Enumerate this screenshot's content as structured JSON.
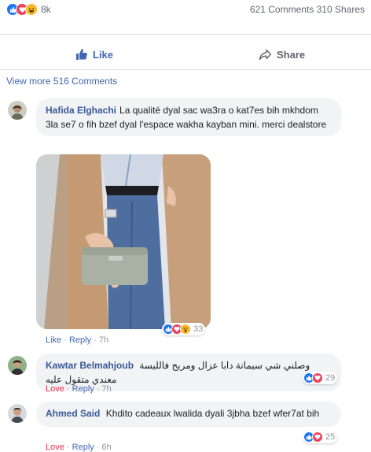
{
  "post": {
    "reaction_count": "8k",
    "comments_shares": "621 Comments 310 Shares",
    "like_label": "Like",
    "share_label": "Share",
    "view_more": "View more 516 Comments"
  },
  "comments": [
    {
      "author": "Hafida Elghachi",
      "text": "La qualité dyal sac wa3ra o kat7es bih mkhdom 3la se7 o fih bzef dyal l'espace wakha kayban mini. merci dealstore",
      "actions": [
        "Like",
        "Reply",
        "7h"
      ],
      "reactions": "33"
    },
    {
      "author": "Kawtar Belmahjoub",
      "text": "وصلني شي سيمانة دابا عزال ومريح فالليسة معندي متقول عليه",
      "actions": [
        "Love",
        "Reply",
        "7h"
      ],
      "reactions": "29"
    },
    {
      "author": "Ahmed Said",
      "text": "Khdito cadeaux lwalida dyali 3jbha bzef wfer7at bih",
      "actions": [
        "Love",
        "Reply",
        "6h"
      ],
      "reactions": "25"
    }
  ],
  "colors": {
    "brand": "#4267b2",
    "like": "#1877f2",
    "love": "#f33e58",
    "haha": "#f7b928"
  },
  "icons": [
    "like-icon",
    "love-icon",
    "haha-icon",
    "wow-icon",
    "thumbs-up-icon",
    "share-arrow-icon"
  ]
}
